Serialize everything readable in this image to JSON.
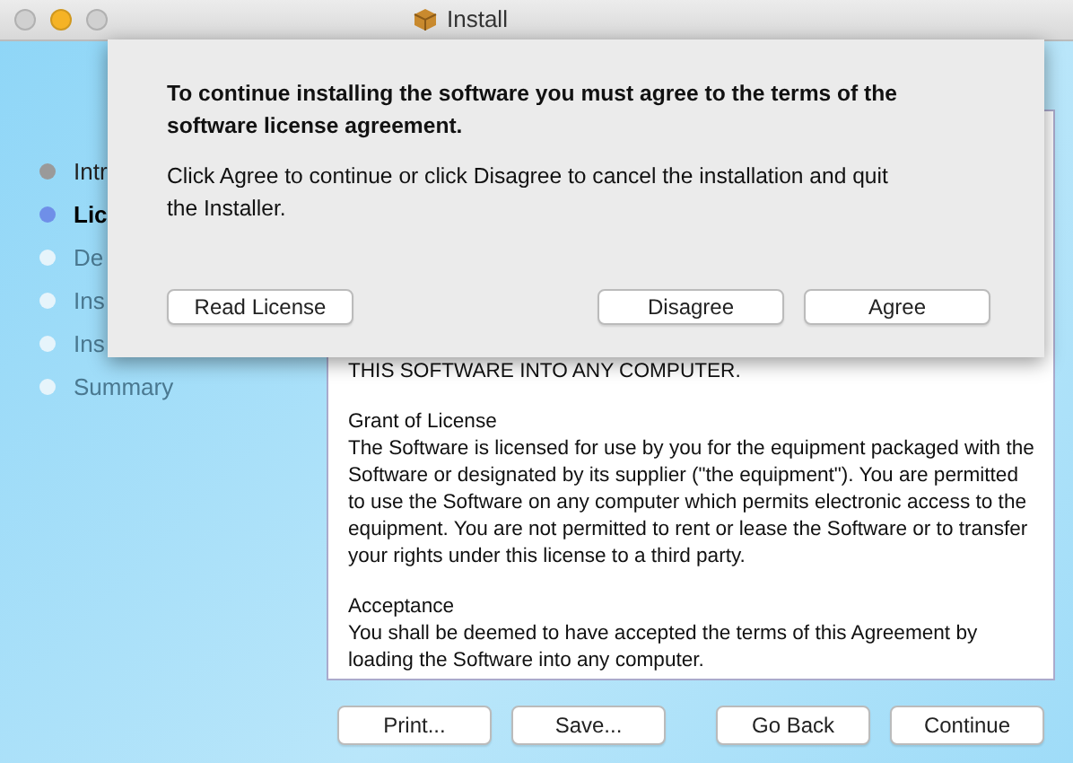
{
  "window": {
    "title": "Install"
  },
  "steps": [
    {
      "label": "Intr",
      "selected": false,
      "completed": true
    },
    {
      "label": "Lic",
      "selected": true,
      "completed": false
    },
    {
      "label": "De",
      "selected": false,
      "completed": false
    },
    {
      "label": "Ins",
      "selected": false,
      "completed": false
    },
    {
      "label": "Ins",
      "selected": false,
      "completed": false
    },
    {
      "label": "Summary",
      "selected": false,
      "completed": false
    }
  ],
  "license": {
    "paragraphs": [
      {
        "body": "THIS SOFTWARE INTO ANY COMPUTER."
      },
      {
        "heading": "Grant of License",
        "body": "The Software is licensed for use by you for the equipment packaged with the Software or designated by its supplier (\"the equipment\"). You are permitted to use the Software on any computer which permits electronic access to the equipment. You are not permitted to rent or lease the Software or to transfer your rights under this license to a third party."
      },
      {
        "heading": "Acceptance",
        "body": "You shall be deemed to have accepted the terms of this Agreement by loading the Software into any computer."
      }
    ]
  },
  "buttons": {
    "left": [
      "Print...",
      "Save..."
    ],
    "right": [
      "Go Back",
      "Continue"
    ]
  },
  "sheet": {
    "title": "To continue installing the software you must agree to the terms of the software license agreement.",
    "message": "Click Agree to continue or click Disagree to cancel the installation and quit the Installer.",
    "buttons_left": [
      "Read License"
    ],
    "buttons_right": [
      "Disagree",
      "Agree"
    ]
  }
}
